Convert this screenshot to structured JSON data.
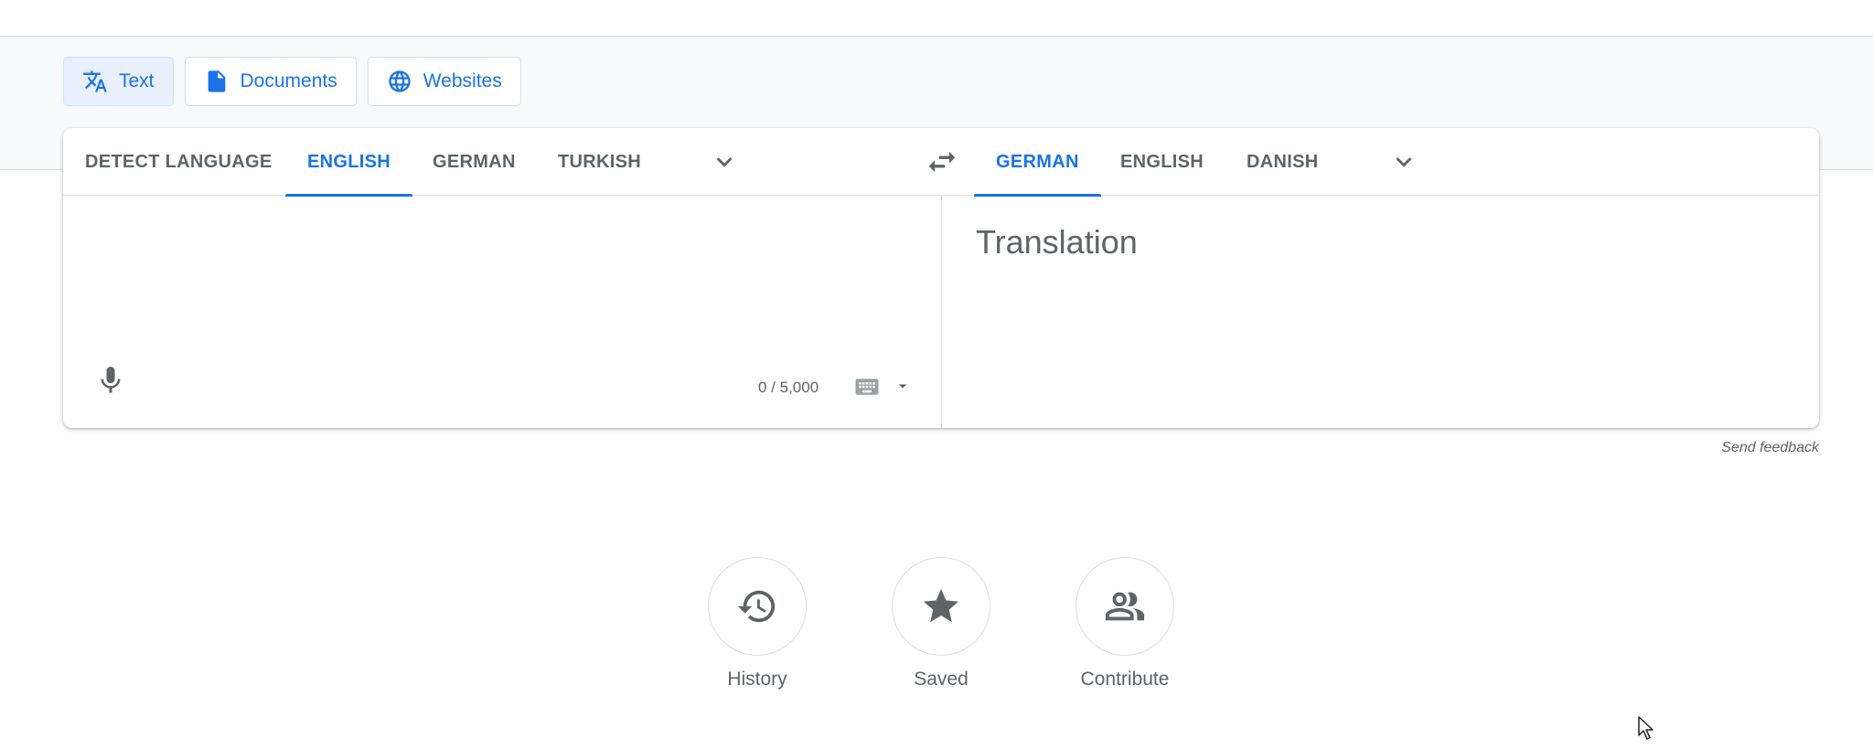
{
  "mode_tabs": [
    {
      "label": "Text",
      "icon": "translate-icon",
      "active": true
    },
    {
      "label": "Documents",
      "icon": "document-icon",
      "active": false
    },
    {
      "label": "Websites",
      "icon": "globe-icon",
      "active": false
    }
  ],
  "source_languages": [
    {
      "label": "DETECT LANGUAGE",
      "selected": false
    },
    {
      "label": "ENGLISH",
      "selected": true
    },
    {
      "label": "GERMAN",
      "selected": false
    },
    {
      "label": "TURKISH",
      "selected": false
    }
  ],
  "target_languages": [
    {
      "label": "GERMAN",
      "selected": true
    },
    {
      "label": "ENGLISH",
      "selected": false
    },
    {
      "label": "DANISH",
      "selected": false
    }
  ],
  "source": {
    "char_count": "0 / 5,000"
  },
  "target": {
    "placeholder": "Translation"
  },
  "feedback_link": "Send feedback",
  "shortcuts": [
    {
      "label": "History",
      "icon": "history-icon"
    },
    {
      "label": "Saved",
      "icon": "star-icon"
    },
    {
      "label": "Contribute",
      "icon": "people-icon"
    }
  ],
  "colors": {
    "accent": "#1a73e8",
    "text_muted": "#5f6368",
    "border": "#dadce0"
  }
}
